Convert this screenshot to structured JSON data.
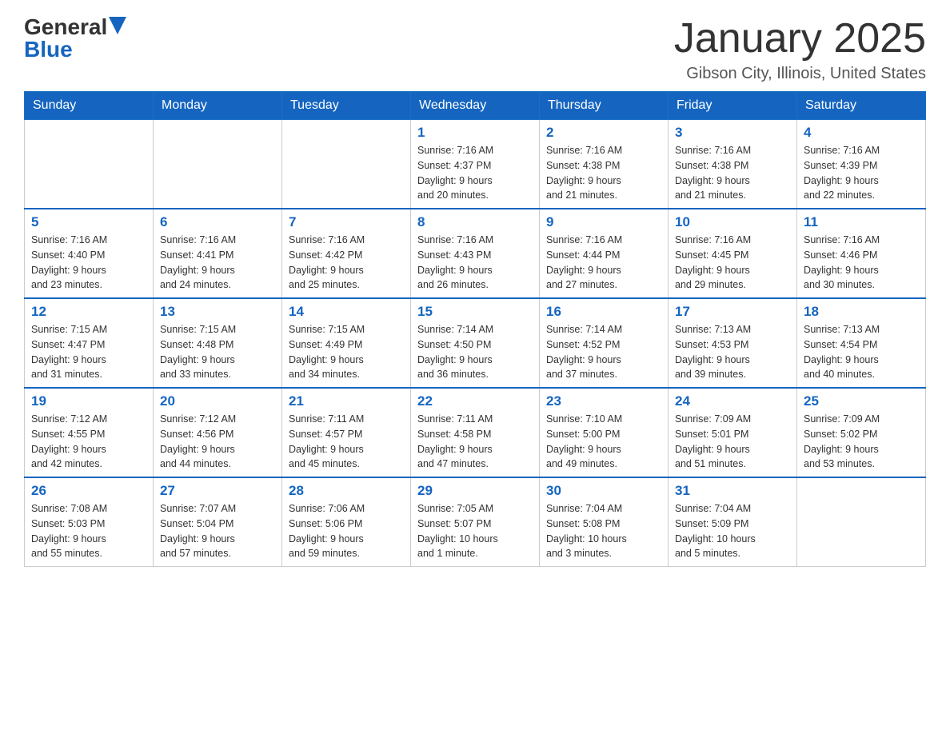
{
  "logo": {
    "general": "General",
    "blue": "Blue"
  },
  "title": "January 2025",
  "location": "Gibson City, Illinois, United States",
  "days_of_week": [
    "Sunday",
    "Monday",
    "Tuesday",
    "Wednesday",
    "Thursday",
    "Friday",
    "Saturday"
  ],
  "weeks": [
    [
      {
        "day": "",
        "info": ""
      },
      {
        "day": "",
        "info": ""
      },
      {
        "day": "",
        "info": ""
      },
      {
        "day": "1",
        "info": "Sunrise: 7:16 AM\nSunset: 4:37 PM\nDaylight: 9 hours\nand 20 minutes."
      },
      {
        "day": "2",
        "info": "Sunrise: 7:16 AM\nSunset: 4:38 PM\nDaylight: 9 hours\nand 21 minutes."
      },
      {
        "day": "3",
        "info": "Sunrise: 7:16 AM\nSunset: 4:38 PM\nDaylight: 9 hours\nand 21 minutes."
      },
      {
        "day": "4",
        "info": "Sunrise: 7:16 AM\nSunset: 4:39 PM\nDaylight: 9 hours\nand 22 minutes."
      }
    ],
    [
      {
        "day": "5",
        "info": "Sunrise: 7:16 AM\nSunset: 4:40 PM\nDaylight: 9 hours\nand 23 minutes."
      },
      {
        "day": "6",
        "info": "Sunrise: 7:16 AM\nSunset: 4:41 PM\nDaylight: 9 hours\nand 24 minutes."
      },
      {
        "day": "7",
        "info": "Sunrise: 7:16 AM\nSunset: 4:42 PM\nDaylight: 9 hours\nand 25 minutes."
      },
      {
        "day": "8",
        "info": "Sunrise: 7:16 AM\nSunset: 4:43 PM\nDaylight: 9 hours\nand 26 minutes."
      },
      {
        "day": "9",
        "info": "Sunrise: 7:16 AM\nSunset: 4:44 PM\nDaylight: 9 hours\nand 27 minutes."
      },
      {
        "day": "10",
        "info": "Sunrise: 7:16 AM\nSunset: 4:45 PM\nDaylight: 9 hours\nand 29 minutes."
      },
      {
        "day": "11",
        "info": "Sunrise: 7:16 AM\nSunset: 4:46 PM\nDaylight: 9 hours\nand 30 minutes."
      }
    ],
    [
      {
        "day": "12",
        "info": "Sunrise: 7:15 AM\nSunset: 4:47 PM\nDaylight: 9 hours\nand 31 minutes."
      },
      {
        "day": "13",
        "info": "Sunrise: 7:15 AM\nSunset: 4:48 PM\nDaylight: 9 hours\nand 33 minutes."
      },
      {
        "day": "14",
        "info": "Sunrise: 7:15 AM\nSunset: 4:49 PM\nDaylight: 9 hours\nand 34 minutes."
      },
      {
        "day": "15",
        "info": "Sunrise: 7:14 AM\nSunset: 4:50 PM\nDaylight: 9 hours\nand 36 minutes."
      },
      {
        "day": "16",
        "info": "Sunrise: 7:14 AM\nSunset: 4:52 PM\nDaylight: 9 hours\nand 37 minutes."
      },
      {
        "day": "17",
        "info": "Sunrise: 7:13 AM\nSunset: 4:53 PM\nDaylight: 9 hours\nand 39 minutes."
      },
      {
        "day": "18",
        "info": "Sunrise: 7:13 AM\nSunset: 4:54 PM\nDaylight: 9 hours\nand 40 minutes."
      }
    ],
    [
      {
        "day": "19",
        "info": "Sunrise: 7:12 AM\nSunset: 4:55 PM\nDaylight: 9 hours\nand 42 minutes."
      },
      {
        "day": "20",
        "info": "Sunrise: 7:12 AM\nSunset: 4:56 PM\nDaylight: 9 hours\nand 44 minutes."
      },
      {
        "day": "21",
        "info": "Sunrise: 7:11 AM\nSunset: 4:57 PM\nDaylight: 9 hours\nand 45 minutes."
      },
      {
        "day": "22",
        "info": "Sunrise: 7:11 AM\nSunset: 4:58 PM\nDaylight: 9 hours\nand 47 minutes."
      },
      {
        "day": "23",
        "info": "Sunrise: 7:10 AM\nSunset: 5:00 PM\nDaylight: 9 hours\nand 49 minutes."
      },
      {
        "day": "24",
        "info": "Sunrise: 7:09 AM\nSunset: 5:01 PM\nDaylight: 9 hours\nand 51 minutes."
      },
      {
        "day": "25",
        "info": "Sunrise: 7:09 AM\nSunset: 5:02 PM\nDaylight: 9 hours\nand 53 minutes."
      }
    ],
    [
      {
        "day": "26",
        "info": "Sunrise: 7:08 AM\nSunset: 5:03 PM\nDaylight: 9 hours\nand 55 minutes."
      },
      {
        "day": "27",
        "info": "Sunrise: 7:07 AM\nSunset: 5:04 PM\nDaylight: 9 hours\nand 57 minutes."
      },
      {
        "day": "28",
        "info": "Sunrise: 7:06 AM\nSunset: 5:06 PM\nDaylight: 9 hours\nand 59 minutes."
      },
      {
        "day": "29",
        "info": "Sunrise: 7:05 AM\nSunset: 5:07 PM\nDaylight: 10 hours\nand 1 minute."
      },
      {
        "day": "30",
        "info": "Sunrise: 7:04 AM\nSunset: 5:08 PM\nDaylight: 10 hours\nand 3 minutes."
      },
      {
        "day": "31",
        "info": "Sunrise: 7:04 AM\nSunset: 5:09 PM\nDaylight: 10 hours\nand 5 minutes."
      },
      {
        "day": "",
        "info": ""
      }
    ]
  ]
}
